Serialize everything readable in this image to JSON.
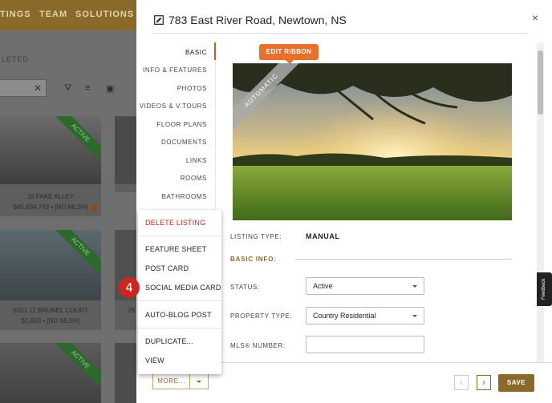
{
  "background": {
    "nav": [
      "TINGS",
      "TEAM",
      "SOLUTIONS"
    ],
    "filter_label": "LETED",
    "cards": [
      {
        "name": "15 FAKE ALLEY",
        "meta": "$45,634,763 • [NO MLS®]",
        "ribbon": "ACTIVE"
      },
      {
        "name": "5201 11 BRUNEL COURT",
        "meta": "$1,650 • [NO MLS®]",
        "ribbon": "ACTIVE"
      },
      {
        "name": "",
        "meta": "",
        "ribbon": "ACTIVE"
      }
    ],
    "partial_caption": "29"
  },
  "modal": {
    "title": "783 East River Road, Newtown, NS",
    "close": "×",
    "nav": [
      "BASIC",
      "INFO & FEATURES",
      "PHOTOS",
      "VIDEOS & V.TOURS",
      "FLOOR PLANS",
      "DOCUMENTS",
      "LINKS",
      "ROOMS",
      "BATHROOMS"
    ],
    "edit_ribbon": "EDIT RIBBON",
    "photo_ribbon": "AUTOMATIC",
    "listing_type_label": "LISTING TYPE:",
    "listing_type_value": "MANUAL",
    "basic_info_heading": "BASIC INFO:",
    "status_label": "STATUS:",
    "status_value": "Active",
    "property_type_label": "PROPERTY TYPE:",
    "property_type_value": "Country Residential",
    "mls_label": "MLS® NUMBER:",
    "mls_value": "",
    "more_button": "MORE...",
    "prev": "‹",
    "next": "›",
    "save_button": "SAVE"
  },
  "menu": {
    "items": [
      "DELETE LISTING",
      "FEATURE SHEET",
      "POST CARD",
      "SOCIAL MEDIA CARD",
      "AUTO-BLOG POST",
      "DUPLICATE...",
      "VIEW"
    ],
    "step_badge": "4"
  },
  "feedback": "Feedback",
  "colors": {
    "accent": "#8a6a2a",
    "orange": "#e8702a",
    "danger": "#c0261e",
    "active": "#2b6a2b"
  }
}
